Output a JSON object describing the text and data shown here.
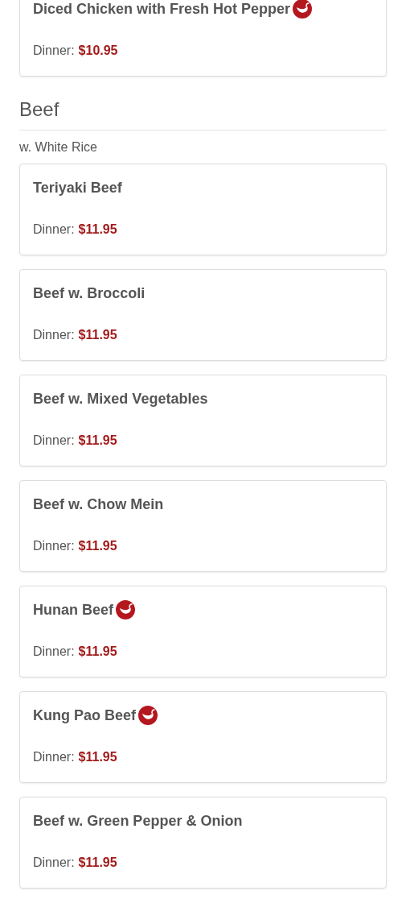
{
  "sections": [
    {
      "items": [
        {
          "name": "Diced Chicken with Fresh Hot Pepper",
          "spicy": true,
          "price_label": "Dinner:",
          "price": "$10.95"
        }
      ]
    },
    {
      "title": "Beef",
      "subtitle": "w. White Rice",
      "items": [
        {
          "name": "Teriyaki Beef",
          "spicy": false,
          "price_label": "Dinner:",
          "price": "$11.95"
        },
        {
          "name": "Beef w. Broccoli",
          "spicy": false,
          "price_label": "Dinner:",
          "price": "$11.95"
        },
        {
          "name": "Beef w. Mixed Vegetables",
          "spicy": false,
          "price_label": "Dinner:",
          "price": "$11.95"
        },
        {
          "name": "Beef w. Chow Mein",
          "spicy": false,
          "price_label": "Dinner:",
          "price": "$11.95"
        },
        {
          "name": "Hunan Beef",
          "spicy": true,
          "price_label": "Dinner:",
          "price": "$11.95"
        },
        {
          "name": "Kung Pao Beef",
          "spicy": true,
          "price_label": "Dinner:",
          "price": "$11.95"
        },
        {
          "name": "Beef w. Green Pepper & Onion",
          "spicy": false,
          "price_label": "Dinner:",
          "price": "$11.95"
        }
      ]
    }
  ]
}
